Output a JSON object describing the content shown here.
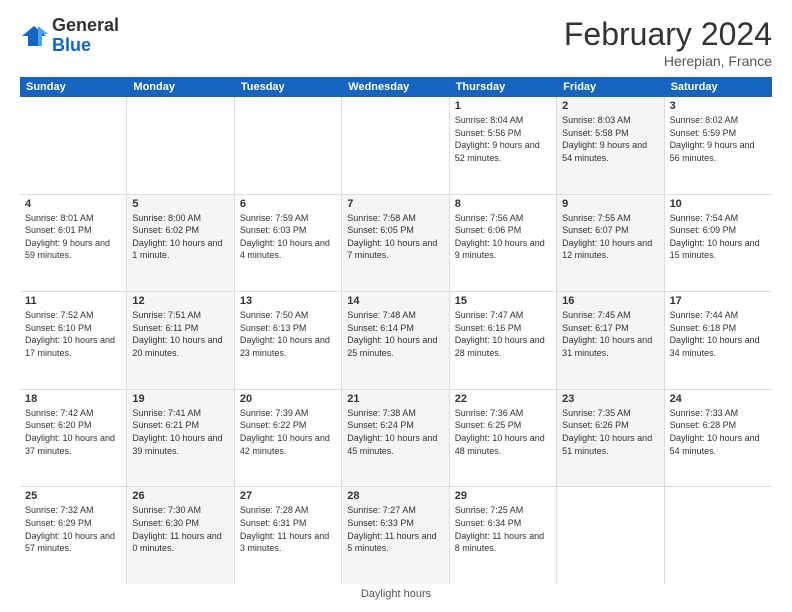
{
  "logo": {
    "general": "General",
    "blue": "Blue"
  },
  "title": "February 2024",
  "subtitle": "Herepian, France",
  "days_of_week": [
    "Sunday",
    "Monday",
    "Tuesday",
    "Wednesday",
    "Thursday",
    "Friday",
    "Saturday"
  ],
  "footer": "Daylight hours",
  "weeks": [
    [
      {
        "day": "",
        "info": "",
        "shaded": false
      },
      {
        "day": "",
        "info": "",
        "shaded": false
      },
      {
        "day": "",
        "info": "",
        "shaded": false
      },
      {
        "day": "",
        "info": "",
        "shaded": false
      },
      {
        "day": "1",
        "info": "Sunrise: 8:04 AM\nSunset: 5:56 PM\nDaylight: 9 hours and 52 minutes.",
        "shaded": false
      },
      {
        "day": "2",
        "info": "Sunrise: 8:03 AM\nSunset: 5:58 PM\nDaylight: 9 hours and 54 minutes.",
        "shaded": true
      },
      {
        "day": "3",
        "info": "Sunrise: 8:02 AM\nSunset: 5:59 PM\nDaylight: 9 hours and 56 minutes.",
        "shaded": false
      }
    ],
    [
      {
        "day": "4",
        "info": "Sunrise: 8:01 AM\nSunset: 6:01 PM\nDaylight: 9 hours and 59 minutes.",
        "shaded": false
      },
      {
        "day": "5",
        "info": "Sunrise: 8:00 AM\nSunset: 6:02 PM\nDaylight: 10 hours and 1 minute.",
        "shaded": true
      },
      {
        "day": "6",
        "info": "Sunrise: 7:59 AM\nSunset: 6:03 PM\nDaylight: 10 hours and 4 minutes.",
        "shaded": false
      },
      {
        "day": "7",
        "info": "Sunrise: 7:58 AM\nSunset: 6:05 PM\nDaylight: 10 hours and 7 minutes.",
        "shaded": true
      },
      {
        "day": "8",
        "info": "Sunrise: 7:56 AM\nSunset: 6:06 PM\nDaylight: 10 hours and 9 minutes.",
        "shaded": false
      },
      {
        "day": "9",
        "info": "Sunrise: 7:55 AM\nSunset: 6:07 PM\nDaylight: 10 hours and 12 minutes.",
        "shaded": true
      },
      {
        "day": "10",
        "info": "Sunrise: 7:54 AM\nSunset: 6:09 PM\nDaylight: 10 hours and 15 minutes.",
        "shaded": false
      }
    ],
    [
      {
        "day": "11",
        "info": "Sunrise: 7:52 AM\nSunset: 6:10 PM\nDaylight: 10 hours and 17 minutes.",
        "shaded": false
      },
      {
        "day": "12",
        "info": "Sunrise: 7:51 AM\nSunset: 6:11 PM\nDaylight: 10 hours and 20 minutes.",
        "shaded": true
      },
      {
        "day": "13",
        "info": "Sunrise: 7:50 AM\nSunset: 6:13 PM\nDaylight: 10 hours and 23 minutes.",
        "shaded": false
      },
      {
        "day": "14",
        "info": "Sunrise: 7:48 AM\nSunset: 6:14 PM\nDaylight: 10 hours and 25 minutes.",
        "shaded": true
      },
      {
        "day": "15",
        "info": "Sunrise: 7:47 AM\nSunset: 6:16 PM\nDaylight: 10 hours and 28 minutes.",
        "shaded": false
      },
      {
        "day": "16",
        "info": "Sunrise: 7:45 AM\nSunset: 6:17 PM\nDaylight: 10 hours and 31 minutes.",
        "shaded": true
      },
      {
        "day": "17",
        "info": "Sunrise: 7:44 AM\nSunset: 6:18 PM\nDaylight: 10 hours and 34 minutes.",
        "shaded": false
      }
    ],
    [
      {
        "day": "18",
        "info": "Sunrise: 7:42 AM\nSunset: 6:20 PM\nDaylight: 10 hours and 37 minutes.",
        "shaded": false
      },
      {
        "day": "19",
        "info": "Sunrise: 7:41 AM\nSunset: 6:21 PM\nDaylight: 10 hours and 39 minutes.",
        "shaded": true
      },
      {
        "day": "20",
        "info": "Sunrise: 7:39 AM\nSunset: 6:22 PM\nDaylight: 10 hours and 42 minutes.",
        "shaded": false
      },
      {
        "day": "21",
        "info": "Sunrise: 7:38 AM\nSunset: 6:24 PM\nDaylight: 10 hours and 45 minutes.",
        "shaded": true
      },
      {
        "day": "22",
        "info": "Sunrise: 7:36 AM\nSunset: 6:25 PM\nDaylight: 10 hours and 48 minutes.",
        "shaded": false
      },
      {
        "day": "23",
        "info": "Sunrise: 7:35 AM\nSunset: 6:26 PM\nDaylight: 10 hours and 51 minutes.",
        "shaded": true
      },
      {
        "day": "24",
        "info": "Sunrise: 7:33 AM\nSunset: 6:28 PM\nDaylight: 10 hours and 54 minutes.",
        "shaded": false
      }
    ],
    [
      {
        "day": "25",
        "info": "Sunrise: 7:32 AM\nSunset: 6:29 PM\nDaylight: 10 hours and 57 minutes.",
        "shaded": false
      },
      {
        "day": "26",
        "info": "Sunrise: 7:30 AM\nSunset: 6:30 PM\nDaylight: 11 hours and 0 minutes.",
        "shaded": true
      },
      {
        "day": "27",
        "info": "Sunrise: 7:28 AM\nSunset: 6:31 PM\nDaylight: 11 hours and 3 minutes.",
        "shaded": false
      },
      {
        "day": "28",
        "info": "Sunrise: 7:27 AM\nSunset: 6:33 PM\nDaylight: 11 hours and 5 minutes.",
        "shaded": true
      },
      {
        "day": "29",
        "info": "Sunrise: 7:25 AM\nSunset: 6:34 PM\nDaylight: 11 hours and 8 minutes.",
        "shaded": false
      },
      {
        "day": "",
        "info": "",
        "shaded": false
      },
      {
        "day": "",
        "info": "",
        "shaded": false
      }
    ]
  ]
}
